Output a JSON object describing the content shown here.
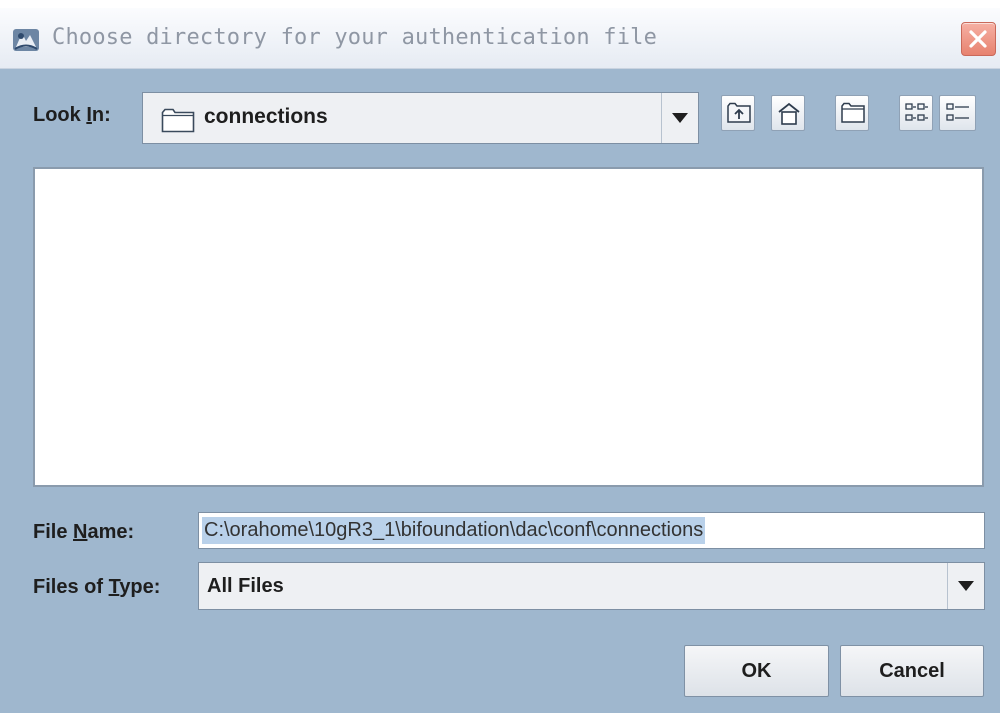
{
  "window": {
    "title": "Choose directory for your authentication file",
    "title_icon": "java-duke-app-icon",
    "close_icon": "close-icon"
  },
  "look_in": {
    "label_prefix": "Look ",
    "label_mnemonic": "I",
    "label_suffix": "n:",
    "selected": "connections",
    "folder_icon": "folder-icon"
  },
  "toolbar": {
    "buttons": [
      "up-one-level-icon",
      "home-icon",
      "new-folder-icon",
      "list-view-icon",
      "details-view-icon"
    ]
  },
  "file_name": {
    "label_prefix": "File ",
    "label_mnemonic": "N",
    "label_suffix": "ame:",
    "value": "C:\\orahome\\10gR3_1\\bifoundation\\dac\\conf\\connections"
  },
  "files_of_type": {
    "label_prefix": "Files of ",
    "label_mnemonic": "T",
    "label_suffix": "ype:",
    "selected": "All Files"
  },
  "buttons": {
    "ok": "OK",
    "cancel": "Cancel"
  },
  "colors": {
    "panel_bg": "#9fb7ce",
    "selection": "#b9d1ea",
    "close_button": "#e7826f"
  }
}
